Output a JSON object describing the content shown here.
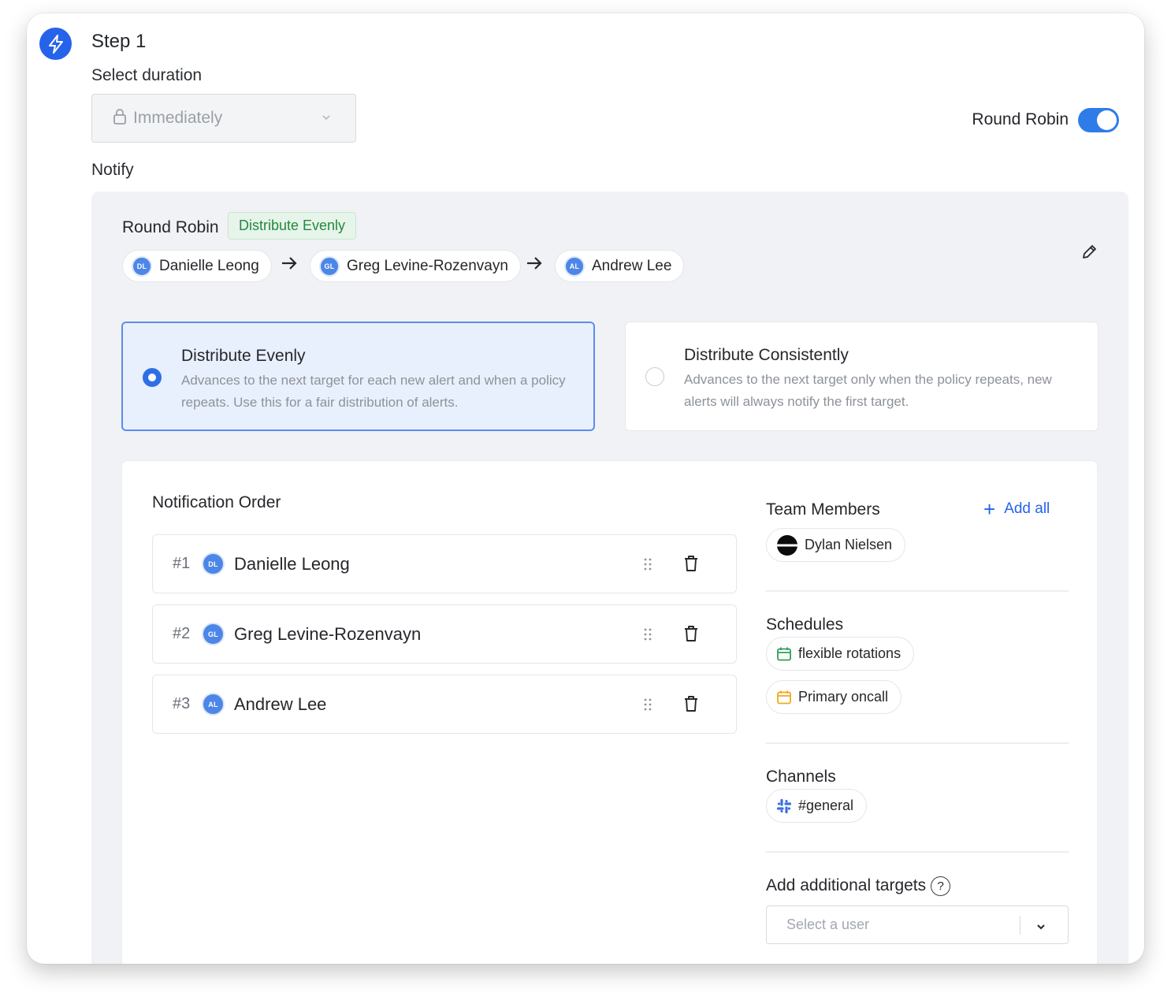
{
  "step": {
    "title": "Step 1",
    "icon": "lightning-bolt-icon"
  },
  "duration": {
    "label": "Select duration",
    "value": "Immediately",
    "locked": true
  },
  "round_robin_toggle": {
    "label": "Round Robin",
    "enabled": true
  },
  "notify": {
    "label": "Notify"
  },
  "round_robin": {
    "title": "Round Robin",
    "badge": "Distribute Evenly",
    "sequence": [
      {
        "initials": "DL",
        "name": "Danielle Leong"
      },
      {
        "initials": "GL",
        "name": "Greg Levine-Rozenvayn"
      },
      {
        "initials": "AL",
        "name": "Andrew Lee"
      }
    ]
  },
  "options": [
    {
      "title": "Distribute Evenly",
      "desc": "Advances to the next target for each new alert and when a policy repeats. Use this for a fair distribution of alerts.",
      "selected": true
    },
    {
      "title": "Distribute Consistently",
      "desc": "Advances to the next target only when the policy repeats, new alerts will always notify the first target.",
      "selected": false
    }
  ],
  "notification_order": {
    "title": "Notification Order",
    "rows": [
      {
        "num": "#1",
        "initials": "DL",
        "name": "Danielle Leong"
      },
      {
        "num": "#2",
        "initials": "GL",
        "name": "Greg Levine-Rozenvayn"
      },
      {
        "num": "#3",
        "initials": "AL",
        "name": "Andrew Lee"
      }
    ]
  },
  "team_members": {
    "title": "Team Members",
    "add_all": "Add all",
    "items": [
      "Dylan Nielsen"
    ]
  },
  "schedules": {
    "title": "Schedules",
    "items": [
      {
        "name": "flexible rotations",
        "color": "#2e9e5b"
      },
      {
        "name": "Primary oncall",
        "color": "#f0a91c"
      }
    ]
  },
  "channels": {
    "title": "Channels",
    "items": [
      "#general"
    ]
  },
  "additional_targets": {
    "title": "Add additional targets",
    "help": "?",
    "placeholder": "Select a user"
  },
  "colors": {
    "accent": "#2563eb",
    "avatar": "#4c86e6",
    "badge_green": "#23893e"
  }
}
